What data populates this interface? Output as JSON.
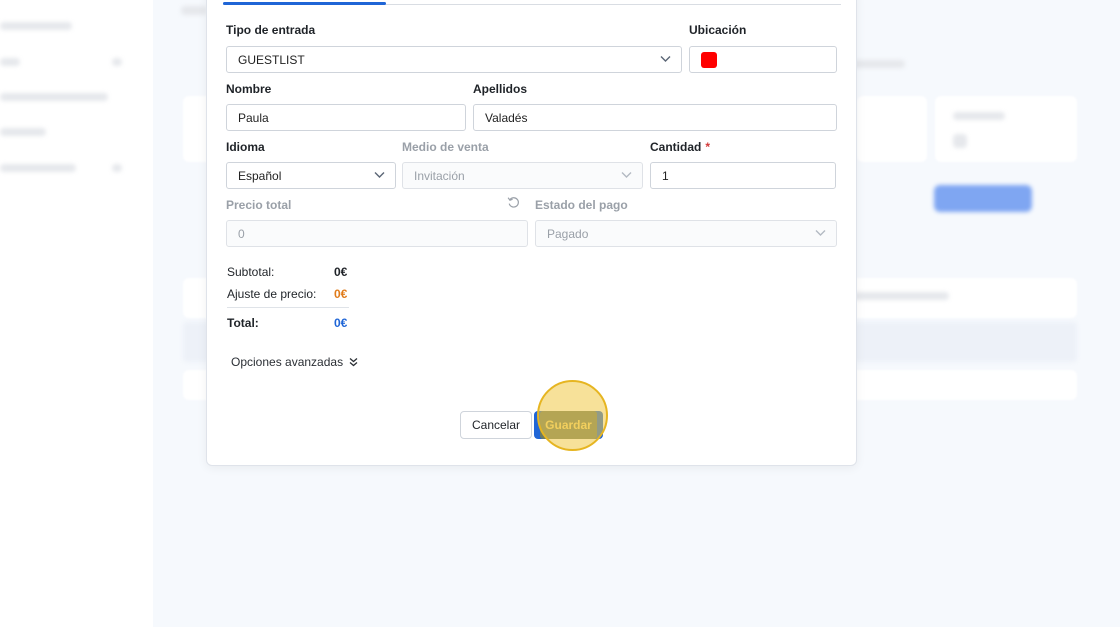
{
  "form": {
    "ticket_type": {
      "label": "Tipo de entrada",
      "value": "GUESTLIST"
    },
    "location": {
      "label": "Ubicación",
      "swatch_color": "#ff0000"
    },
    "first_name": {
      "label": "Nombre",
      "value": "Paula"
    },
    "last_name": {
      "label": "Apellidos",
      "value": "Valadés"
    },
    "language": {
      "label": "Idioma",
      "value": "Español"
    },
    "sales_channel": {
      "label": "Medio de venta",
      "value": "Invitación"
    },
    "quantity": {
      "label": "Cantidad",
      "required_mark": "*",
      "value": "1"
    },
    "total_price": {
      "label": "Precio total",
      "placeholder": "0"
    },
    "payment_status": {
      "label": "Estado del pago",
      "value": "Pagado"
    }
  },
  "summary": {
    "subtotal_label": "Subtotal:",
    "subtotal_value": "0€",
    "adjust_label": "Ajuste de precio:",
    "adjust_value": "0€",
    "total_label": "Total:",
    "total_value": "0€"
  },
  "advanced_options": "Opciones avanzadas",
  "actions": {
    "cancel": "Cancelar",
    "save": "Guardar"
  },
  "colors": {
    "accent": "#1f65d6",
    "adjust": "#e07b1a",
    "total": "#1f65d6",
    "required": "#d23a3a"
  }
}
